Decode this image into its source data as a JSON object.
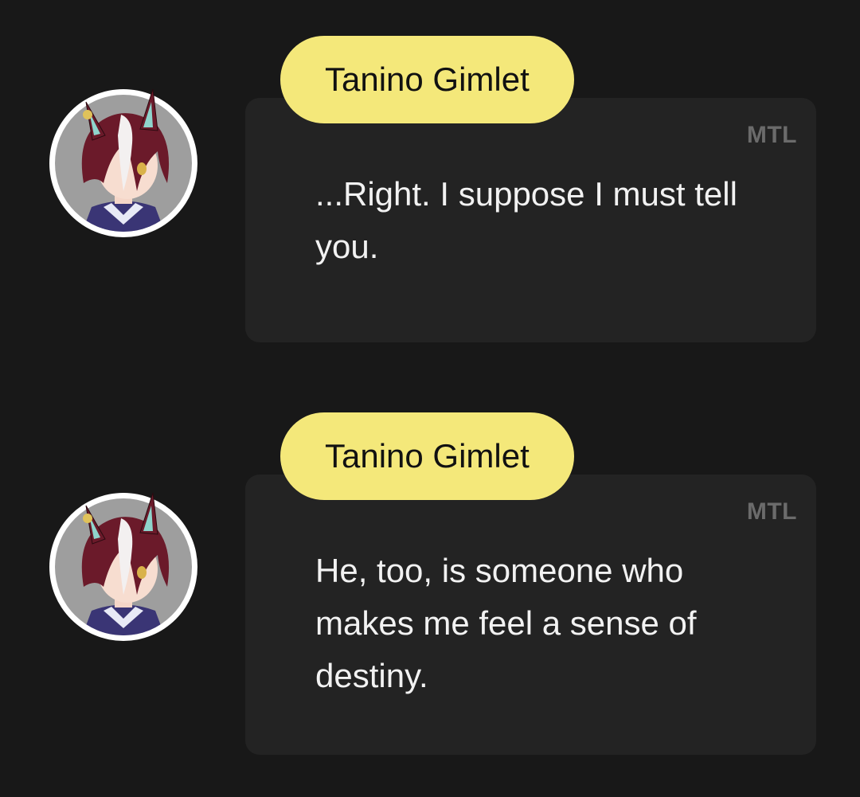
{
  "messages": [
    {
      "speaker": "Tanino Gimlet",
      "badge": "MTL",
      "text": "...Right. I suppose I must tell you."
    },
    {
      "speaker": "Tanino Gimlet",
      "badge": "MTL",
      "text": "He, too, is someone who makes me feel a sense of destiny."
    }
  ],
  "colors": {
    "background": "#181818",
    "bubble": "#232323",
    "name_tag": "#f4e87a",
    "text": "#f2f2f2",
    "badge": "#6b6b6b"
  },
  "icons": {
    "avatar": "character-portrait-icon"
  }
}
